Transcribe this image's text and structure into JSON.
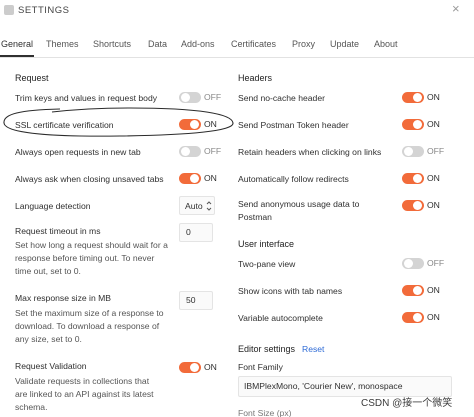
{
  "header": {
    "title": "SETTINGS",
    "close_glyph": "×"
  },
  "tabs": [
    {
      "label": "General",
      "active": true
    },
    {
      "label": "Themes"
    },
    {
      "label": "Shortcuts"
    },
    {
      "label": "Data"
    },
    {
      "label": "Add-ons"
    },
    {
      "label": "Certificates"
    },
    {
      "label": "Proxy"
    },
    {
      "label": "Update"
    },
    {
      "label": "About"
    }
  ],
  "request": {
    "heading": "Request",
    "trim_keys": {
      "label": "Trim keys and values in request body",
      "state": "OFF"
    },
    "ssl_verification": {
      "label": "SSL certificate verification",
      "state": "ON"
    },
    "open_new_tab": {
      "label": "Always open requests in new tab",
      "state": "OFF"
    },
    "ask_unsaved": {
      "label": "Always ask when closing unsaved tabs",
      "state": "ON"
    },
    "language_detection": {
      "label": "Language detection",
      "value": "Auto"
    },
    "timeout": {
      "label": "Request timeout in ms",
      "desc": "Set how long a request should wait for a response before timing out. To never time out, set to 0.",
      "value": "0"
    },
    "max_response": {
      "label": "Max response size in MB",
      "desc": "Set the maximum size of a response to download. To download a response of any size, set to 0.",
      "value": "50"
    },
    "validation": {
      "label": "Request Validation",
      "desc": "Validate requests in collections that are linked to an API against its latest schema.",
      "state": "ON"
    }
  },
  "headers": {
    "heading": "Headers",
    "no_cache": {
      "label": "Send no-cache header",
      "state": "ON"
    },
    "postman_token": {
      "label": "Send Postman Token header",
      "state": "ON"
    },
    "retain_headers": {
      "label": "Retain headers when clicking on links",
      "state": "OFF"
    },
    "follow_redirects": {
      "label": "Automatically follow redirects",
      "state": "ON"
    },
    "anon_usage": {
      "label": "Send anonymous usage data to Postman",
      "state": "ON"
    }
  },
  "user_interface": {
    "heading": "User interface",
    "two_pane": {
      "label": "Two-pane view",
      "state": "OFF"
    },
    "show_icons": {
      "label": "Show icons with tab names",
      "state": "ON"
    },
    "var_autocomplete": {
      "label": "Variable autocomplete",
      "state": "ON"
    }
  },
  "editor": {
    "heading": "Editor settings",
    "reset_label": "Reset",
    "font_family_label": "Font Family",
    "font_family_value": "IBMPlexMono, 'Courier New', monospace",
    "font_size_label": "Font Size (px)"
  },
  "watermark": "CSDN @接一个微笑",
  "colors": {
    "toggle_on": "#f26b3a",
    "toggle_off": "#d4d4d4",
    "annotation": "#2b2b2b",
    "link": "#2d6ad6"
  },
  "icons": {
    "select_chevron": "chevron-down-icon",
    "close": "close-icon"
  }
}
